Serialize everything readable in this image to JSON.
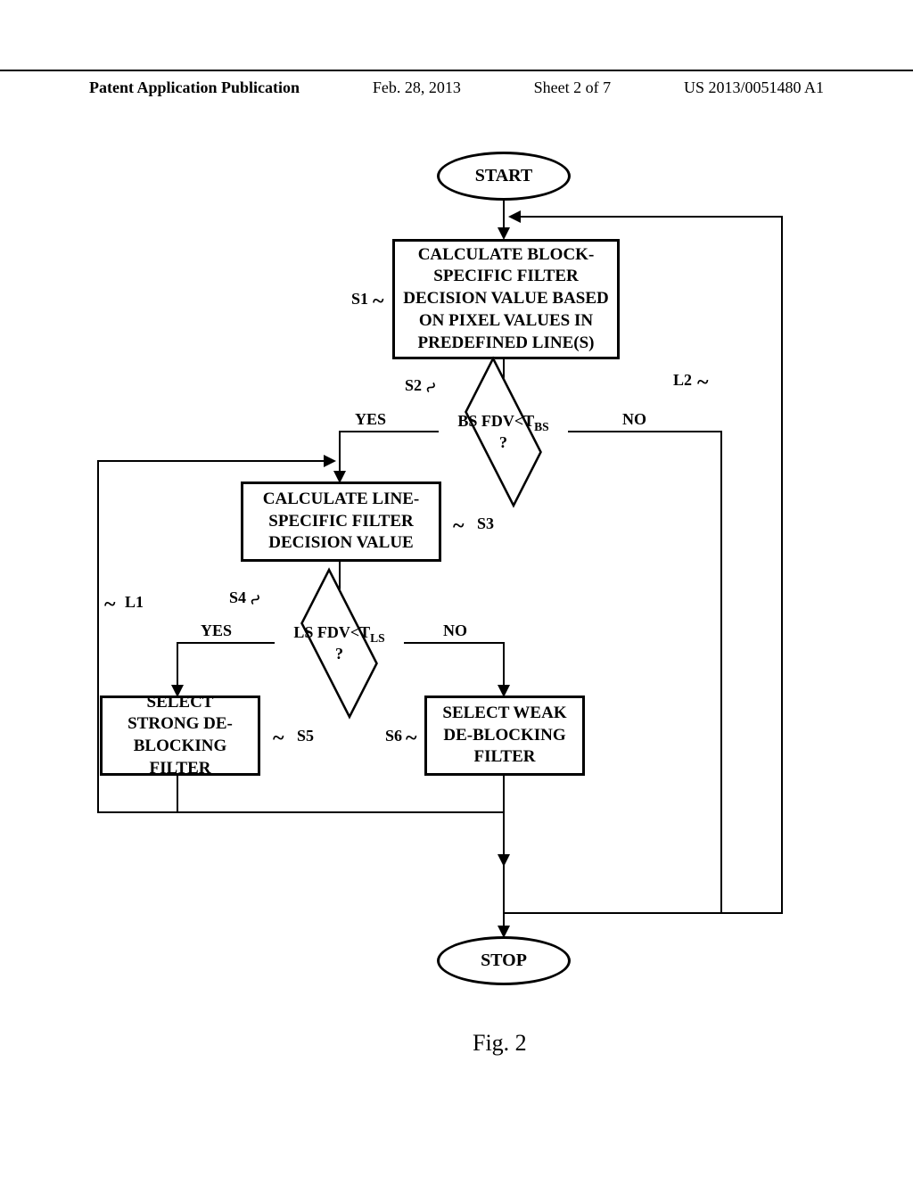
{
  "header": {
    "left": "Patent Application Publication",
    "date": "Feb. 28, 2013",
    "sheet": "Sheet 2 of 7",
    "pubno": "US 2013/0051480 A1"
  },
  "nodes": {
    "start": "START",
    "stop": "STOP",
    "s1": "CALCULATE BLOCK-SPECIFIC FILTER DECISION VALUE BASED ON PIXEL VALUES IN PREDEFINED LINE(S)",
    "s2_main": "BS FDV<T",
    "s2_sub": "BS",
    "s2_q": "?",
    "s3": "CALCULATE LINE-SPECIFIC FILTER DECISION VALUE",
    "s4_main": "LS FDV<T",
    "s4_sub": "LS",
    "s4_q": "?",
    "s5": "SELECT STRONG DE-BLOCKING FILTER",
    "s6": "SELECT WEAK DE-BLOCKING FILTER"
  },
  "labels": {
    "s1": "S1",
    "s2": "S2",
    "s3": "S3",
    "s4": "S4",
    "s5": "S5",
    "s6": "S6",
    "l1": "L1",
    "l2": "L2",
    "yes": "YES",
    "no": "NO"
  },
  "figure": "Fig. 2"
}
